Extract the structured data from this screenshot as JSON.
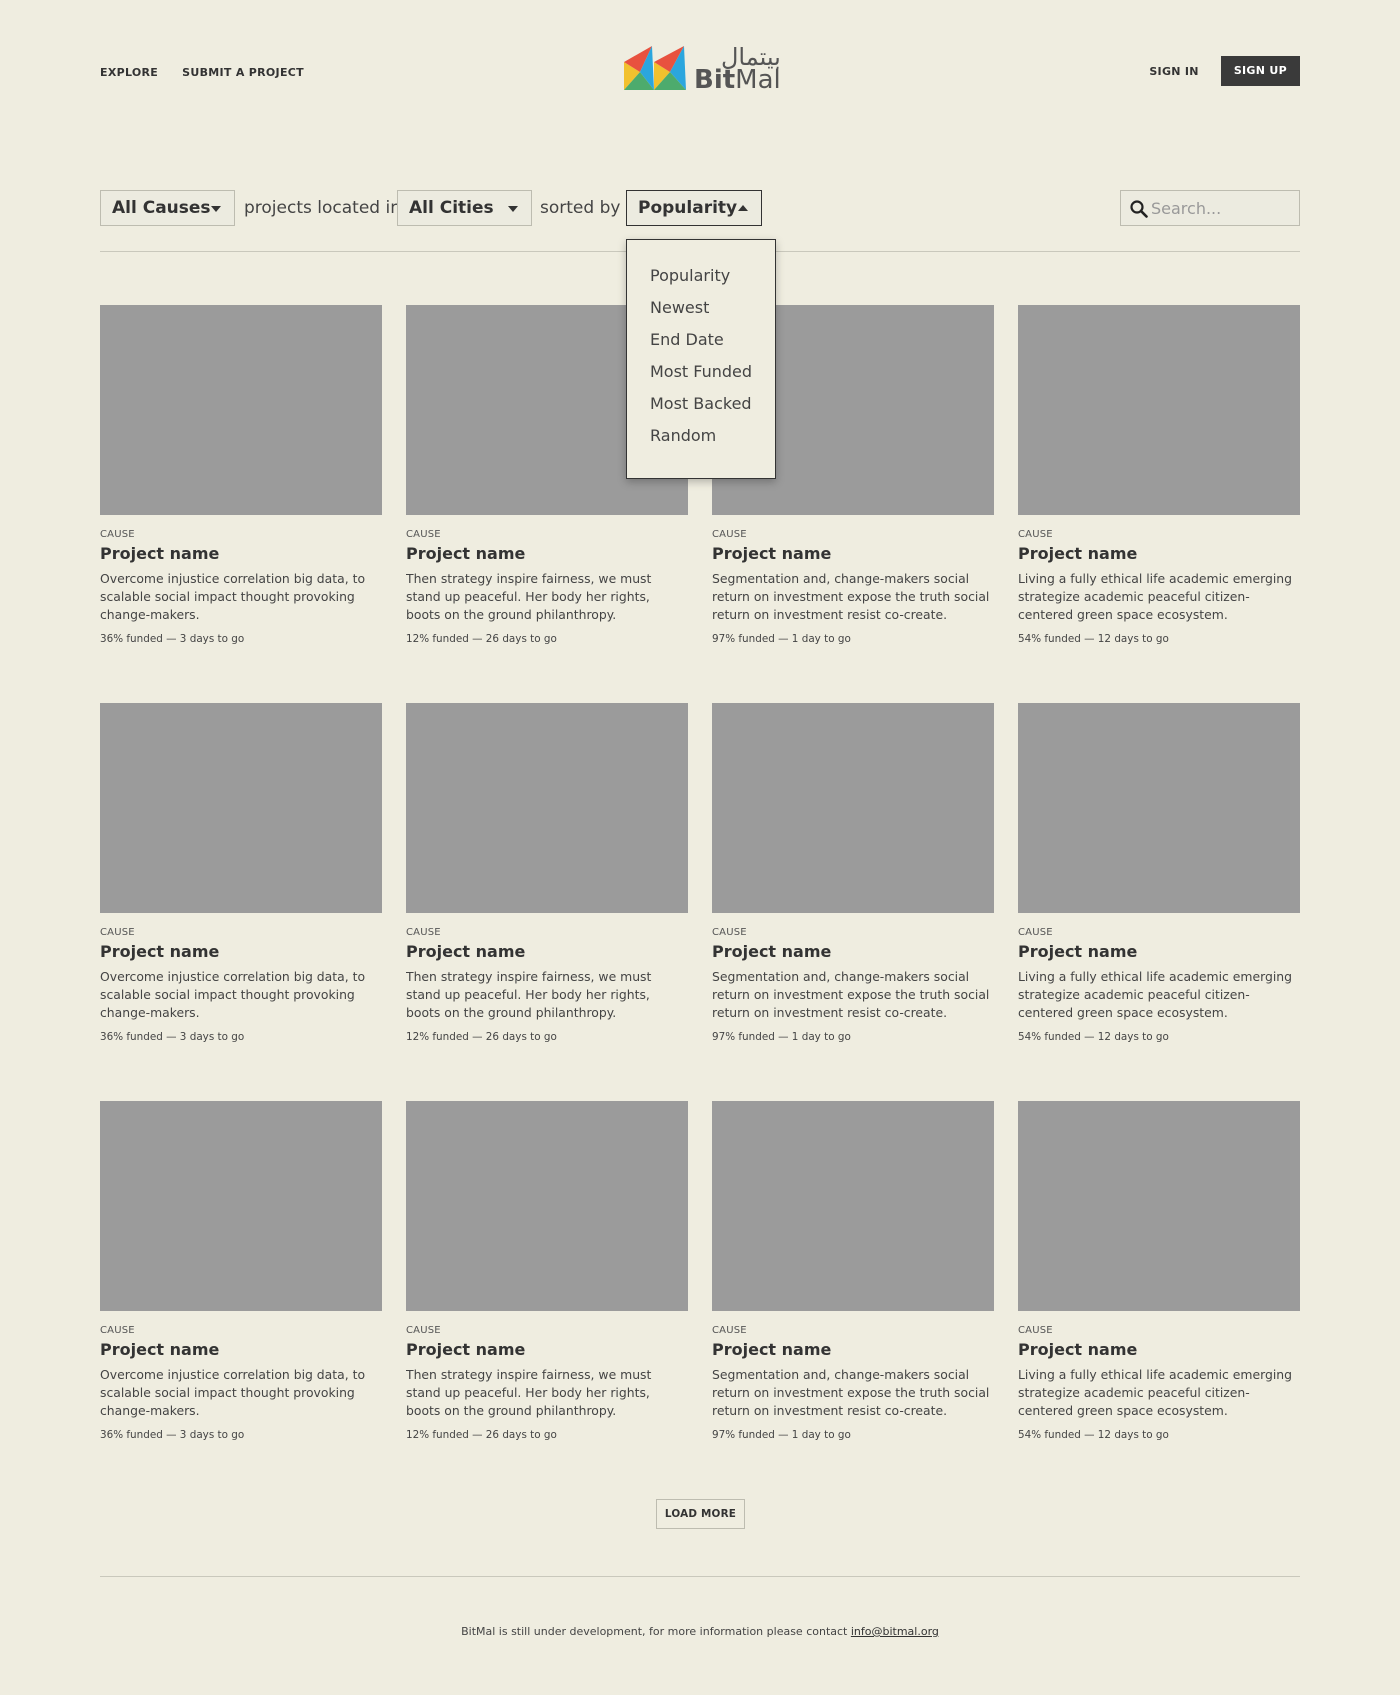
{
  "nav": {
    "explore": "EXPLORE",
    "submit": "SUBMIT A PROJECT",
    "sign_in": "SIGN IN",
    "sign_up": "SIGN UP"
  },
  "logo": {
    "arabic": "بيتمال",
    "latin_bold": "Bit",
    "latin_rest": "Mal",
    "colors": [
      "#f2c12e",
      "#e8523f",
      "#2ba6de",
      "#4dab6d"
    ]
  },
  "filters": {
    "cause_selected": "All Causes",
    "located_text": "projects located in",
    "city_selected": "All Cities",
    "sorted_text": "sorted by",
    "sort_selected": "Popularity",
    "search_placeholder": "Search..."
  },
  "sort_options": [
    "Popularity",
    "Newest",
    "End Date",
    "Most Funded",
    "Most Backed",
    "Random"
  ],
  "projects": [
    {
      "cause": "CAUSE",
      "name": "Project name",
      "description": "Overcome injustice correlation big data, to scalable social impact thought provoking change-makers.",
      "status": "36% funded — 3 days to go"
    },
    {
      "cause": "CAUSE",
      "name": "Project name",
      "description": "Then strategy inspire fairness, we must stand up peaceful. Her body her rights, boots on the ground philanthropy.",
      "status": "12% funded — 26 days to go"
    },
    {
      "cause": "CAUSE",
      "name": "Project name",
      "description": "Segmentation and, change-makers social return on investment expose the truth social return on investment resist co-create.",
      "status": "97% funded — 1 day to go"
    },
    {
      "cause": "CAUSE",
      "name": "Project name",
      "description": "Living a fully ethical life academic emerging strategize academic peaceful citizen-centered green space ecosystem.",
      "status": "54% funded — 12 days to go"
    },
    {
      "cause": "CAUSE",
      "name": "Project name",
      "description": "Overcome injustice correlation big data, to scalable social impact thought provoking change-makers.",
      "status": "36% funded — 3 days to go"
    },
    {
      "cause": "CAUSE",
      "name": "Project name",
      "description": "Then strategy inspire fairness, we must stand up peaceful. Her body her rights, boots on the ground philanthropy.",
      "status": "12% funded — 26 days to go"
    },
    {
      "cause": "CAUSE",
      "name": "Project name",
      "description": "Segmentation and, change-makers social return on investment expose the truth social return on investment resist co-create.",
      "status": "97% funded — 1 day to go"
    },
    {
      "cause": "CAUSE",
      "name": "Project name",
      "description": "Living a fully ethical life academic emerging strategize academic peaceful citizen-centered green space ecosystem.",
      "status": "54% funded — 12 days to go"
    },
    {
      "cause": "CAUSE",
      "name": "Project name",
      "description": "Overcome injustice correlation big data, to scalable social impact thought provoking change-makers.",
      "status": "36% funded — 3 days to go"
    },
    {
      "cause": "CAUSE",
      "name": "Project name",
      "description": "Then strategy inspire fairness, we must stand up peaceful. Her body her rights, boots on the ground philanthropy.",
      "status": "12% funded — 26 days to go"
    },
    {
      "cause": "CAUSE",
      "name": "Project name",
      "description": "Segmentation and, change-makers social return on investment expose the truth social return on investment resist co-create.",
      "status": "97% funded — 1 day to go"
    },
    {
      "cause": "CAUSE",
      "name": "Project name",
      "description": "Living a fully ethical life academic emerging strategize academic peaceful citizen-centered green space ecosystem.",
      "status": "54% funded — 12 days to go"
    }
  ],
  "load_more": "LOAD MORE",
  "footer": {
    "text": "BitMal is still under development, for more information please contact",
    "email": "info@bitmal.org"
  }
}
